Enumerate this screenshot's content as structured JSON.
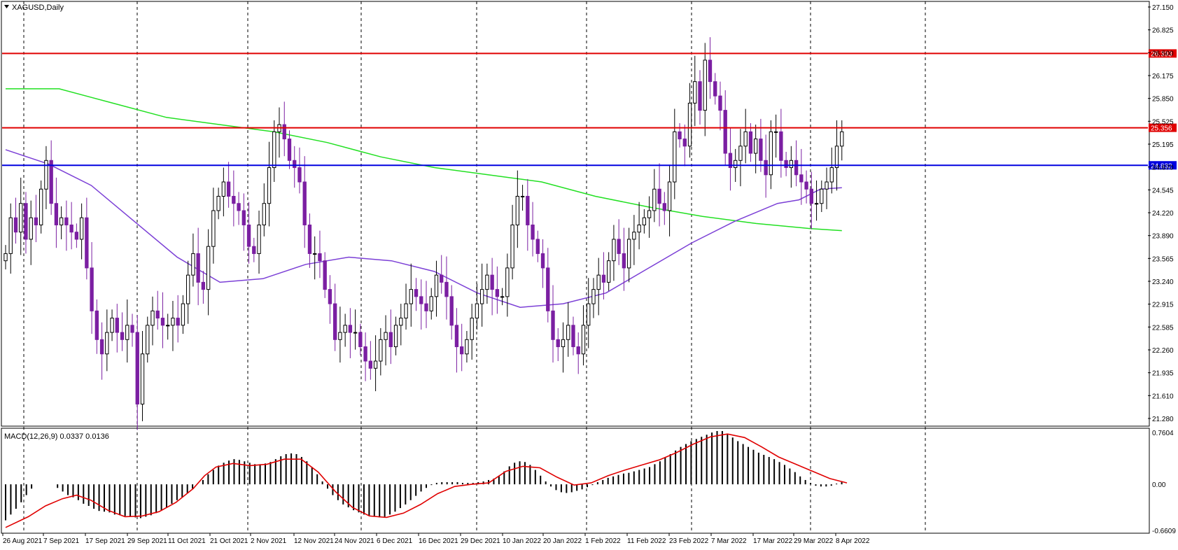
{
  "window": {
    "symbol_label": "XAGUSD,Daily",
    "indicator_label": "MACD(12,26,9) 0.0337 0.0136"
  },
  "colors": {
    "background": "#ffffff",
    "bull_body": "#ffffff",
    "bear_body": "#7b1fa2",
    "candle_outline": "#000000",
    "ma_short": "#7b3fd6",
    "ma_long": "#22e022",
    "resistance": "#e00000",
    "support": "#0000e0",
    "macd_hist": "#000000",
    "macd_signal": "#e00000",
    "grid": "#000000"
  },
  "chart_data": [
    {
      "type": "candlestick",
      "title": "XAGUSD,Daily",
      "ylim": [
        21.28,
        27.1
      ],
      "y_ticks": [
        "27.150",
        "26.825",
        "26.500",
        "26.175",
        "25.850",
        "25.525",
        "25.195",
        "24.870",
        "24.545",
        "24.220",
        "23.890",
        "23.565",
        "23.240",
        "22.915",
        "22.585",
        "22.260",
        "21.935",
        "21.610",
        "21.280"
      ],
      "x_tick_labels": [
        "26 Aug 2021",
        "7 Sep 2021",
        "17 Sep 2021",
        "29 Sep 2021",
        "11 Oct 2021",
        "21 Oct 2021",
        "2 Nov 2021",
        "12 Nov 2021",
        "24 Nov 2021",
        "6 Dec 2021",
        "16 Dec 2021",
        "29 Dec 2021",
        "10 Jan 2022",
        "20 Jan 2022",
        "1 Feb 2022",
        "11 Feb 2022",
        "23 Feb 2022",
        "7 Mar 2022",
        "17 Mar 2022",
        "29 Mar 2022",
        "8 Apr 2022"
      ],
      "horizontal_lines": [
        {
          "value": 26.393,
          "label": "26.393",
          "color": "#e00000"
        },
        {
          "value": 25.356,
          "label": "25.356",
          "color": "#e00000"
        },
        {
          "value": 24.832,
          "label": "24.832",
          "color": "#0000e0"
        }
      ],
      "close_values": [
        23.6,
        24.1,
        23.9,
        24.3,
        23.8,
        24.1,
        24.0,
        24.5,
        24.9,
        24.3,
        24.0,
        24.1,
        24.0,
        23.9,
        23.8,
        24.1,
        23.4,
        22.8,
        22.4,
        22.2,
        22.5,
        22.7,
        22.5,
        22.4,
        22.6,
        22.5,
        21.5,
        22.2,
        22.6,
        22.8,
        22.7,
        22.6,
        22.6,
        22.7,
        22.6,
        22.9,
        23.3,
        23.6,
        23.2,
        23.1,
        23.7,
        24.2,
        24.4,
        24.6,
        24.4,
        24.3,
        24.2,
        24.0,
        23.7,
        23.6,
        24.0,
        24.3,
        24.8,
        25.3,
        25.4,
        25.2,
        24.9,
        24.8,
        24.6,
        24.0,
        23.6,
        23.6,
        23.5,
        23.1,
        22.9,
        22.4,
        22.5,
        22.6,
        22.5,
        22.5,
        22.3,
        22.1,
        22.0,
        22.1,
        22.4,
        22.5,
        22.3,
        22.6,
        22.7,
        22.9,
        23.1,
        23.0,
        22.9,
        22.8,
        23.0,
        23.3,
        23.2,
        23.0,
        22.6,
        22.3,
        22.2,
        22.4,
        22.7,
        22.9,
        23.1,
        23.3,
        23.1,
        23.0,
        23.0,
        23.4,
        24.0,
        24.4,
        24.4,
        24.0,
        23.8,
        23.6,
        23.4,
        22.8,
        22.4,
        22.3,
        22.4,
        22.6,
        22.3,
        22.2,
        22.6,
        22.9,
        23.1,
        23.3,
        23.2,
        23.5,
        23.8,
        23.6,
        23.4,
        23.8,
        23.9,
        24.0,
        24.1,
        24.2,
        24.5,
        24.3,
        24.2,
        24.6,
        25.3,
        25.2,
        25.1,
        25.7,
        26.0,
        25.6,
        26.3,
        26.0,
        25.8,
        25.6,
        25.0,
        24.8,
        24.9,
        25.1,
        25.3,
        25.0,
        25.2,
        24.9,
        24.7,
        25.3,
        25.3,
        24.9,
        24.8,
        24.9,
        24.7,
        24.6,
        24.5,
        24.3,
        24.3,
        24.5,
        24.6,
        24.8,
        25.1,
        25.3
      ]
    },
    {
      "type": "line",
      "name": "Moving average (purple)",
      "points": [
        [
          0,
          25.05
        ],
        [
          8,
          24.85
        ],
        [
          16,
          24.55
        ],
        [
          24,
          24.05
        ],
        [
          32,
          23.55
        ],
        [
          40,
          23.2
        ],
        [
          48,
          23.25
        ],
        [
          56,
          23.45
        ],
        [
          64,
          23.55
        ],
        [
          72,
          23.5
        ],
        [
          80,
          23.35
        ],
        [
          88,
          23.05
        ],
        [
          96,
          22.85
        ],
        [
          104,
          22.9
        ],
        [
          112,
          23.05
        ],
        [
          120,
          23.4
        ],
        [
          128,
          23.75
        ],
        [
          136,
          24.05
        ],
        [
          144,
          24.3
        ],
        [
          148,
          24.35
        ],
        [
          152,
          24.5
        ],
        [
          156,
          24.52
        ]
      ]
    },
    {
      "type": "line",
      "name": "Moving average (green)",
      "points": [
        [
          0,
          25.9
        ],
        [
          10,
          25.9
        ],
        [
          20,
          25.7
        ],
        [
          30,
          25.5
        ],
        [
          40,
          25.4
        ],
        [
          50,
          25.3
        ],
        [
          60,
          25.15
        ],
        [
          70,
          24.95
        ],
        [
          80,
          24.8
        ],
        [
          90,
          24.7
        ],
        [
          100,
          24.6
        ],
        [
          110,
          24.4
        ],
        [
          120,
          24.25
        ],
        [
          130,
          24.12
        ],
        [
          140,
          24.02
        ],
        [
          150,
          23.95
        ],
        [
          156,
          23.92
        ]
      ]
    },
    {
      "type": "bar",
      "title": "MACD(12,26,9) 0.0337 0.0136",
      "ylim": [
        -0.66,
        0.76
      ],
      "y_ticks": [
        "0.7604",
        "0.00",
        "-0.6609"
      ],
      "histogram": [
        -0.5,
        -0.42,
        -0.34,
        -0.25,
        -0.15,
        -0.06,
        0.0,
        0.0,
        0.0,
        0.0,
        -0.05,
        -0.1,
        -0.15,
        -0.18,
        -0.22,
        -0.27,
        -0.3,
        -0.34,
        -0.37,
        -0.38,
        -0.39,
        -0.42,
        -0.43,
        -0.44,
        -0.45,
        -0.46,
        -0.47,
        -0.45,
        -0.43,
        -0.4,
        -0.36,
        -0.32,
        -0.27,
        -0.22,
        -0.18,
        -0.12,
        -0.06,
        0.0,
        0.06,
        0.14,
        0.2,
        0.26,
        0.3,
        0.33,
        0.35,
        0.34,
        0.32,
        0.3,
        0.28,
        0.28,
        0.29,
        0.31,
        0.35,
        0.39,
        0.42,
        0.43,
        0.42,
        0.38,
        0.32,
        0.24,
        0.14,
        0.04,
        -0.06,
        -0.15,
        -0.22,
        -0.28,
        -0.32,
        -0.36,
        -0.39,
        -0.42,
        -0.44,
        -0.45,
        -0.46,
        -0.45,
        -0.42,
        -0.38,
        -0.33,
        -0.28,
        -0.22,
        -0.16,
        -0.1,
        -0.05,
        -0.01,
        0.02,
        0.03,
        0.03,
        0.03,
        0.03,
        0.02,
        0.02,
        0.02,
        0.03,
        0.04,
        0.06,
        0.08,
        0.12,
        0.18,
        0.25,
        0.3,
        0.32,
        0.31,
        0.27,
        0.2,
        0.12,
        0.04,
        -0.03,
        -0.08,
        -0.11,
        -0.12,
        -0.11,
        -0.09,
        -0.07,
        -0.04,
        -0.01,
        0.03,
        0.06,
        0.09,
        0.11,
        0.13,
        0.15,
        0.16,
        0.18,
        0.2,
        0.22,
        0.24,
        0.28,
        0.32,
        0.37,
        0.42,
        0.47,
        0.52,
        0.56,
        0.6,
        0.63,
        0.66,
        0.69,
        0.72,
        0.74,
        0.74,
        0.7,
        0.65,
        0.6,
        0.56,
        0.52,
        0.48,
        0.44,
        0.41,
        0.38,
        0.35,
        0.31,
        0.27,
        0.22,
        0.17,
        0.11,
        0.06,
        0.02,
        -0.02,
        -0.03,
        -0.03,
        -0.02,
        0.01,
        0.03
      ],
      "signal_points": [
        [
          0,
          -0.6
        ],
        [
          8,
          -0.45
        ],
        [
          14,
          -0.3
        ],
        [
          20,
          -0.2
        ],
        [
          25,
          -0.15
        ],
        [
          30,
          -0.22
        ],
        [
          36,
          -0.36
        ],
        [
          42,
          -0.45
        ],
        [
          48,
          -0.44
        ],
        [
          54,
          -0.38
        ],
        [
          60,
          -0.25
        ],
        [
          66,
          -0.06
        ],
        [
          70,
          0.12
        ],
        [
          74,
          0.24
        ],
        [
          80,
          0.29
        ],
        [
          86,
          0.26
        ],
        [
          92,
          0.28
        ],
        [
          98,
          0.35
        ],
        [
          104,
          0.35
        ],
        [
          110,
          0.17
        ],
        [
          116,
          -0.1
        ],
        [
          122,
          -0.32
        ],
        [
          128,
          -0.44
        ],
        [
          134,
          -0.46
        ],
        [
          140,
          -0.4
        ],
        [
          146,
          -0.28
        ],
        [
          152,
          -0.13
        ],
        [
          158,
          -0.03
        ],
        [
          164,
          0.0
        ],
        [
          170,
          0.02
        ],
        [
          176,
          0.18
        ],
        [
          182,
          0.25
        ],
        [
          188,
          0.23
        ],
        [
          194,
          0.1
        ],
        [
          200,
          -0.01
        ],
        [
          206,
          0.02
        ],
        [
          212,
          0.12
        ],
        [
          218,
          0.2
        ],
        [
          224,
          0.27
        ],
        [
          230,
          0.34
        ],
        [
          236,
          0.44
        ],
        [
          242,
          0.56
        ],
        [
          248,
          0.66
        ],
        [
          254,
          0.7
        ],
        [
          260,
          0.65
        ],
        [
          266,
          0.52
        ],
        [
          272,
          0.38
        ],
        [
          278,
          0.28
        ],
        [
          284,
          0.18
        ],
        [
          290,
          0.08
        ],
        [
          296,
          0.02
        ]
      ]
    }
  ]
}
